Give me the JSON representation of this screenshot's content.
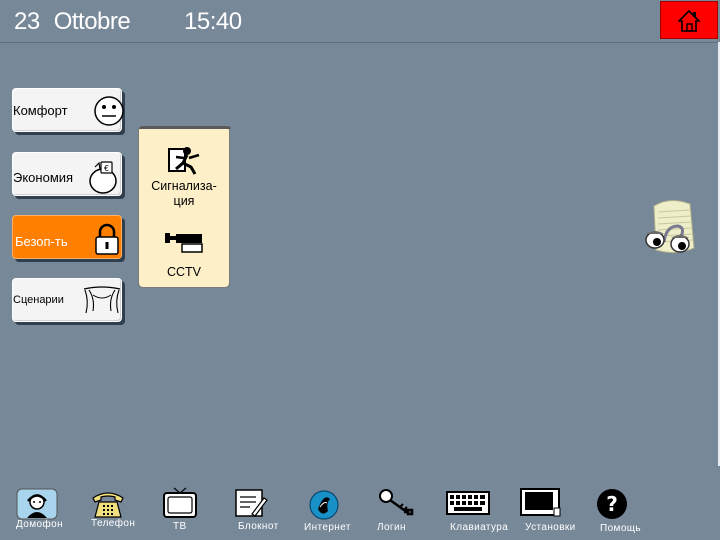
{
  "header": {
    "day": "23",
    "month": "Ottobre",
    "time": "15:40"
  },
  "menu": {
    "items": [
      {
        "label": "Комфорт",
        "icon": "smiley-icon",
        "active": false
      },
      {
        "label": "Экономия",
        "icon": "piggy-bank-icon",
        "active": false
      },
      {
        "label": "Безоп-ть",
        "icon": "padlock-icon",
        "active": true
      },
      {
        "label": "Сценарии",
        "icon": "curtains-icon",
        "active": false
      }
    ]
  },
  "submenu": {
    "items": [
      {
        "label_line1": "Сигнализа-",
        "label_line2": "ция",
        "icon": "burglar-alarm-icon"
      },
      {
        "label": "CCTV",
        "icon": "cctv-camera-icon"
      }
    ]
  },
  "taskbar": {
    "items": [
      {
        "label": "Домофон",
        "icon": "intercom-operator-icon"
      },
      {
        "label": "Телефон",
        "icon": "telephone-icon"
      },
      {
        "label": "ТВ",
        "icon": "tv-icon"
      },
      {
        "label": "Блокнот",
        "icon": "notepad-icon"
      },
      {
        "label": "Интернет",
        "icon": "internet-icon"
      },
      {
        "label": "Логин",
        "icon": "key-icon"
      },
      {
        "label": "Клавиатура",
        "icon": "keyboard-icon"
      },
      {
        "label": "Установки",
        "icon": "monitor-settings-icon"
      },
      {
        "label": "Помощь",
        "icon": "help-icon"
      }
    ]
  },
  "colors": {
    "background": "#778899",
    "active_menu": "#ff8000",
    "home_button": "#ff0000",
    "popup": "#fdf0c8"
  }
}
